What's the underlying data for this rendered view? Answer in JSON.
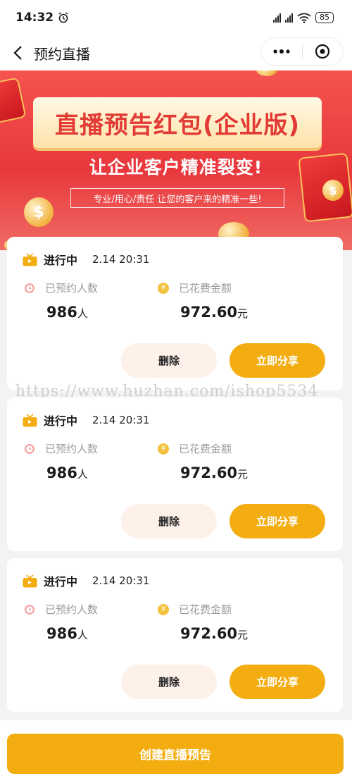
{
  "status_bar": {
    "time": "14:32",
    "battery": "85"
  },
  "nav": {
    "title": "预约直播"
  },
  "banner": {
    "title": "直播预告红包(企业版)",
    "subtitle": "让企业客户精准裂变!",
    "tagline": "专业/用心/责任  让您的客户来的精准一些!"
  },
  "cards": [
    {
      "status": "进行中",
      "time": "2.14 20:31",
      "reserved_label": "已预约人数",
      "reserved_value": "986",
      "reserved_unit": "人",
      "spent_label": "已花费金额",
      "spent_value": "972.60",
      "spent_unit": "元",
      "delete_label": "删除",
      "share_label": "立即分享"
    },
    {
      "status": "进行中",
      "time": "2.14 20:31",
      "reserved_label": "已预约人数",
      "reserved_value": "986",
      "reserved_unit": "人",
      "spent_label": "已花费金额",
      "spent_value": "972.60",
      "spent_unit": "元",
      "delete_label": "删除",
      "share_label": "立即分享"
    },
    {
      "status": "进行中",
      "time": "2.14 20:31",
      "reserved_label": "已预约人数",
      "reserved_value": "986",
      "reserved_unit": "人",
      "spent_label": "已花费金额",
      "spent_value": "972.60",
      "spent_unit": "元",
      "delete_label": "删除",
      "share_label": "立即分享"
    }
  ],
  "watermark": "https://www.huzhan.com/ishop5534",
  "bottom": {
    "create_label": "创建直播预告"
  },
  "colors": {
    "accent": "#f3ad10",
    "banner_red": "#e8383d",
    "delete_bg": "#fdf1ea"
  }
}
